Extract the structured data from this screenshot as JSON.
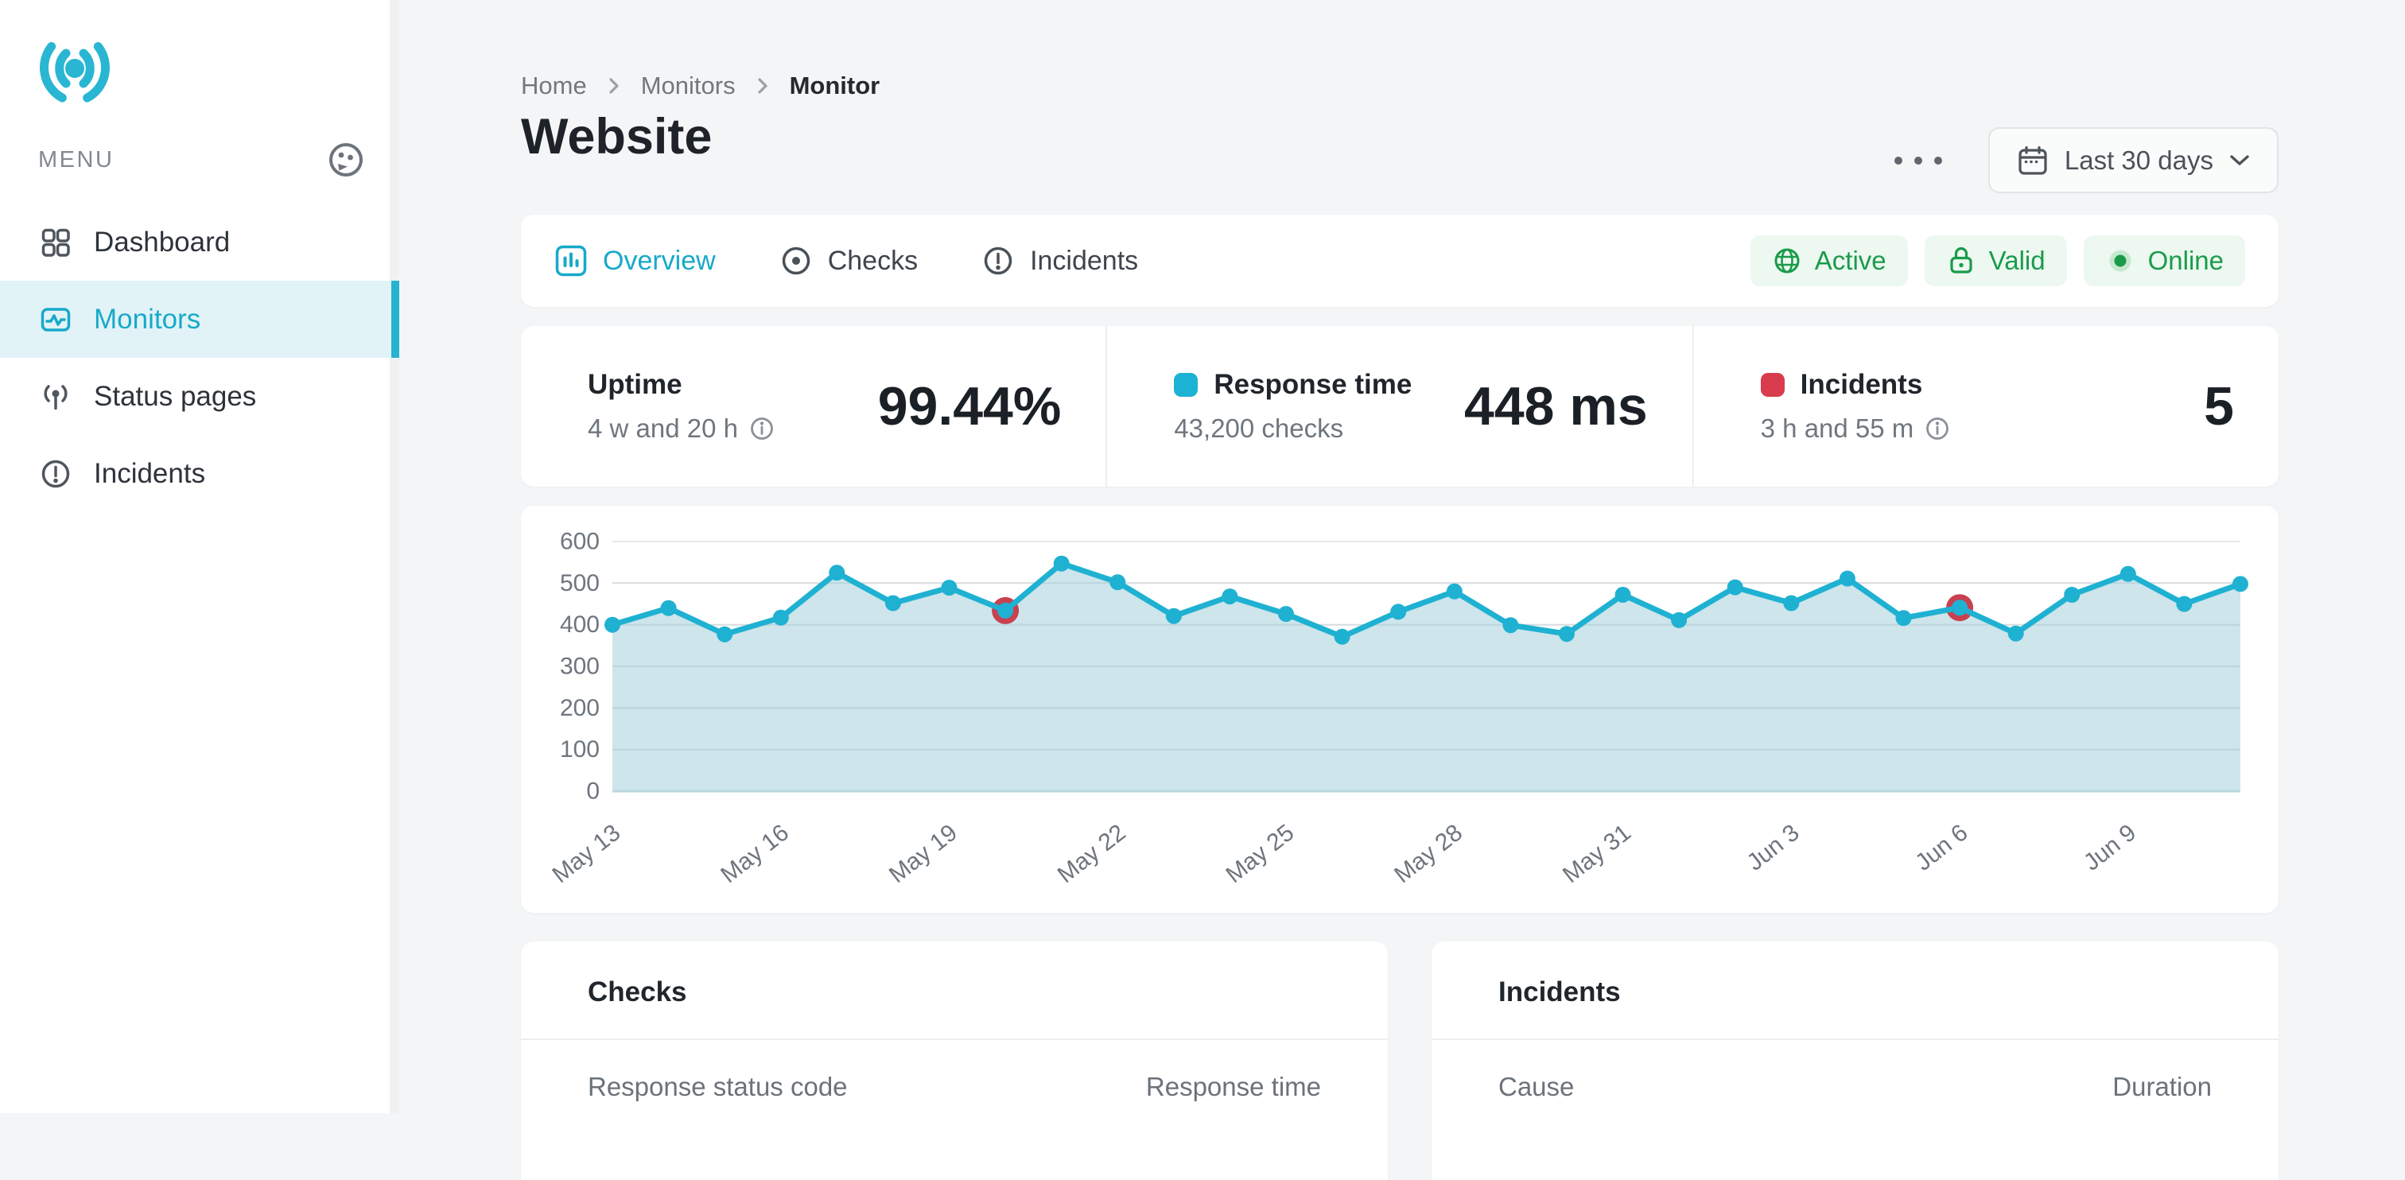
{
  "sidebar": {
    "menu_label": "MENU",
    "items": [
      {
        "label": "Dashboard",
        "active": false
      },
      {
        "label": "Monitors",
        "active": true
      },
      {
        "label": "Status pages",
        "active": false
      },
      {
        "label": "Incidents",
        "active": false
      }
    ]
  },
  "breadcrumb": [
    "Home",
    "Monitors",
    "Monitor"
  ],
  "page": {
    "title": "Website"
  },
  "toolbar": {
    "date_range_label": "Last 30 days"
  },
  "tabs": [
    {
      "label": "Overview",
      "active": true
    },
    {
      "label": "Checks",
      "active": false
    },
    {
      "label": "Incidents",
      "active": false
    }
  ],
  "status_badges": [
    {
      "label": "Active",
      "icon": "globe-icon"
    },
    {
      "label": "Valid",
      "icon": "lock-icon"
    },
    {
      "label": "Online",
      "icon": "online-dot-icon"
    }
  ],
  "stats": [
    {
      "label": "Uptime",
      "subtext": "4 w and 20 h",
      "has_info": true,
      "value": "99.44%",
      "swatch": null
    },
    {
      "label": "Response time",
      "subtext": "43,200 checks",
      "has_info": false,
      "value": "448 ms",
      "swatch": "#1CB2D3"
    },
    {
      "label": "Incidents",
      "subtext": "3 h and 55 m",
      "has_info": true,
      "value": "5",
      "swatch": "#D93C4E"
    }
  ],
  "chart_data": {
    "type": "area",
    "series_name": "Response time (ms)",
    "values": [
      400,
      440,
      377,
      417,
      525,
      452,
      489,
      434,
      547,
      502,
      421,
      468,
      426,
      371,
      431,
      480,
      399,
      378,
      472,
      411,
      490,
      452,
      511,
      416,
      441,
      379,
      472,
      522,
      450,
      498
    ],
    "incident_indices": [
      7,
      24
    ],
    "x_tick_labels": [
      "May 13",
      "May 16",
      "May 19",
      "May 22",
      "May 25",
      "May 28",
      "May 31",
      "Jun 3",
      "Jun 6",
      "Jun 9"
    ],
    "x_tick_indices": [
      0,
      3,
      6,
      9,
      12,
      15,
      18,
      21,
      24,
      27
    ],
    "yticks": [
      0,
      100,
      200,
      300,
      400,
      500,
      600
    ],
    "ylim": [
      0,
      600
    ],
    "grid": true,
    "legend": false,
    "line_color": "#1FB1D2",
    "area_color": "#BFDEE6",
    "incident_color": "#C8414F"
  },
  "bottom_cards": [
    {
      "title": "Checks",
      "columns": [
        "Response status code",
        "Response time"
      ]
    },
    {
      "title": "Incidents",
      "columns": [
        "Cause",
        "Duration"
      ]
    }
  ],
  "colors": {
    "accent_teal": "#1CB2D3",
    "incident_red": "#D93C4E",
    "success_green": "#1A9B4A",
    "badge_bg": "#EDF8F1",
    "active_nav_bg": "#E2F3F8",
    "page_bg": "#F4F5F6",
    "card_bg": "#FFFFFF",
    "grid_line": "#E7E8EA"
  }
}
